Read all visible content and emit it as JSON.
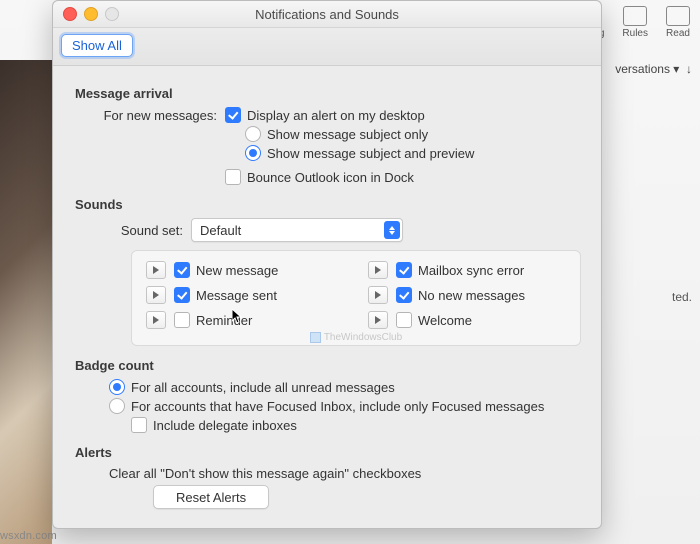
{
  "background": {
    "toolbar_items": {
      "meeting": "Meeting",
      "rules": "Rules",
      "read": "Read"
    },
    "conversations_label": "versations",
    "truncated_right": "ted.",
    "footer_url": "wsxdn.com"
  },
  "window": {
    "title": "Notifications and Sounds",
    "show_all": "Show All"
  },
  "message_arrival": {
    "heading": "Message arrival",
    "for_new_label": "For new messages:",
    "display_alert": {
      "label": "Display an alert on my desktop",
      "checked": true
    },
    "subject_only": {
      "label": "Show message subject only",
      "selected": false
    },
    "subject_preview": {
      "label": "Show message subject and preview",
      "selected": true
    },
    "bounce_dock": {
      "label": "Bounce Outlook icon in Dock",
      "checked": false
    }
  },
  "sounds": {
    "heading": "Sounds",
    "set_label": "Sound set:",
    "set_value": "Default",
    "items": {
      "new_message": {
        "label": "New message",
        "checked": true
      },
      "sync_error": {
        "label": "Mailbox sync error",
        "checked": true
      },
      "message_sent": {
        "label": "Message sent",
        "checked": true
      },
      "no_new": {
        "label": "No new messages",
        "checked": true
      },
      "reminder": {
        "label": "Reminder",
        "checked": false
      },
      "welcome": {
        "label": "Welcome",
        "checked": false
      }
    },
    "watermark": "TheWindowsClub"
  },
  "badge": {
    "heading": "Badge count",
    "all_accounts": {
      "label": "For all accounts, include all unread messages",
      "selected": true
    },
    "focused": {
      "label": "For accounts that have Focused Inbox, include only Focused messages",
      "selected": false
    },
    "delegate": {
      "label": "Include delegate inboxes",
      "checked": false
    }
  },
  "alerts": {
    "heading": "Alerts",
    "clear_text": "Clear all \"Don't show this message again\" checkboxes",
    "reset_button": "Reset Alerts"
  }
}
